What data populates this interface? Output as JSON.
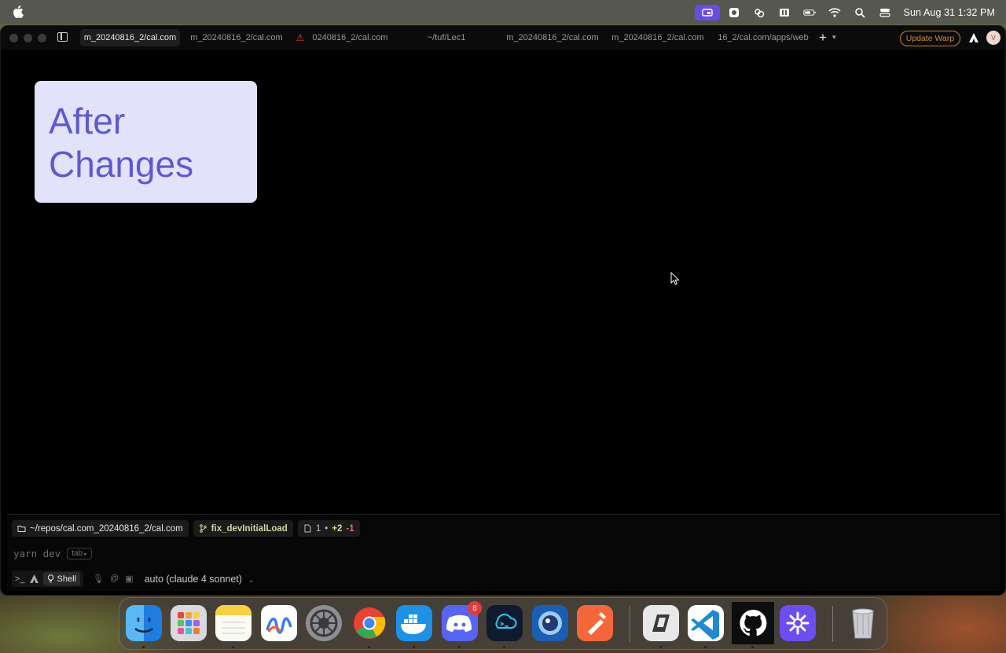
{
  "menubar": {
    "apple_icon": "apple-logo-icon",
    "status_icons": [
      "screen-share-icon",
      "bluetooth-app-icon",
      "weather-icon",
      "focus-icon",
      "battery-icon",
      "wifi-icon",
      "search-icon",
      "control-center-icon"
    ],
    "clock": "Sun Aug 31  1:32 PM"
  },
  "window": {
    "tabs": [
      {
        "label": "m_20240816_2/cal.com",
        "active": true,
        "warning": false
      },
      {
        "label": "m_20240816_2/cal.com",
        "active": false,
        "warning": false
      },
      {
        "label": "0240816_2/cal.com",
        "active": false,
        "warning": true
      },
      {
        "label": "~/tuf/Lec1",
        "active": false,
        "warning": false
      },
      {
        "label": "m_20240816_2/cal.com",
        "active": false,
        "warning": false
      },
      {
        "label": "m_20240816_2/cal.com",
        "active": false,
        "warning": false
      },
      {
        "label": "16_2/cal.com/apps/web",
        "active": false,
        "warning": false
      }
    ],
    "new_tab_symbol": "+",
    "update_button": "Update Warp",
    "user_initial": "V"
  },
  "overlay": {
    "line1": "After",
    "line2": "Changes",
    "bg_color": "#e3e2fb",
    "text_color": "#5d5ad0"
  },
  "input": {
    "directory": "~/repos/cal.com_20240816_2/cal.com",
    "branch": "fix_devInitialLoad",
    "files_changed": "1",
    "bullet": "•",
    "additions": "+2",
    "deletions": "-1",
    "command": "yarn dev",
    "tab_hint": "tab",
    "prompt_symbol": ">_",
    "mode_label": "Shell",
    "model": "auto (claude 4 sonnet)"
  },
  "dock": {
    "apps": [
      "finder",
      "launchpad",
      "notes",
      "freeform",
      "system-settings",
      "chrome",
      "docker",
      "discord",
      "terminal-app",
      "proxyman",
      "postman",
      "parallels",
      "vscode",
      "github-desktop",
      "perplexity",
      "trash"
    ],
    "discord_badge": "8"
  }
}
